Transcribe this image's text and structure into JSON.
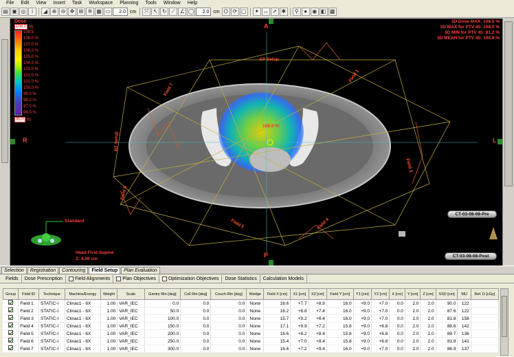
{
  "menu": [
    "File",
    "Edit",
    "View",
    "Insert",
    "Task",
    "Workspace",
    "Planning",
    "Tools",
    "Window",
    "Help"
  ],
  "toolbar": {
    "zoom_value": "2.0",
    "zoom_unit": "cm",
    "zoom2_value": "2.0",
    "zoom2_unit": "cm"
  },
  "dose_legend": {
    "title": "Dose",
    "max_value": "108.0",
    "unit": "%",
    "levels": [
      "108.5",
      "108.0 %",
      "107.0 %",
      "106.0 %",
      "105.0 %",
      "104.0 %",
      "103.0 %",
      "102.0 %",
      "101.0 %",
      "100.0 %",
      "99.0 %",
      "98.0 %",
      "97.0 %",
      "96.0 %"
    ],
    "min_value": "95.0"
  },
  "dose_stats": [
    "3D Dose MAX: 108.5 %",
    "3D MAX for PTV 45: 108.0 %",
    "3D MIN for PTV 45: 91.2 %",
    "3D MEAN for PTV 45: 100.9 %"
  ],
  "orientation": {
    "anterior": "A",
    "posterior": "P",
    "right": "R",
    "left": "L"
  },
  "isocenter_label": "108.9 %",
  "field_labels": [
    "AP Setup",
    "Field 1",
    "Field 2",
    "Field 3",
    "Field 4",
    "Field 5",
    "Field 6",
    "Field 7",
    "RT Setup"
  ],
  "patient": {
    "model_label": "Standard",
    "position": "Head First-Supine",
    "z": "Z: 4.00 cm"
  },
  "ct_tags": {
    "pre": "CT-03-08-08-Pre",
    "post": "CT-03-08-08-Post"
  },
  "workspace_tabs": [
    "Selection",
    "Registration",
    "Contouring",
    "Field Setup",
    "Plan Evaluation"
  ],
  "active_workspace_tab": "Field Setup",
  "sub_tabs": [
    {
      "label": "Fields",
      "checkbox": false
    },
    {
      "label": "Dose Prescription",
      "checkbox": false
    },
    {
      "label": "Field Alignments",
      "checkbox": true
    },
    {
      "label": "Plan Objectives",
      "checkbox": true
    },
    {
      "label": "Optimization Objectives",
      "checkbox": true
    },
    {
      "label": "Dose Statistics",
      "checkbox": false
    },
    {
      "label": "Calculation Models",
      "checkbox": false
    }
  ],
  "table": {
    "headers": [
      "Group",
      "Field ID",
      "Technique",
      "Machine/Energy",
      "Weight",
      "Scale",
      "Gantry Rtn [deg]",
      "Coll Rtn [deg]",
      "Couch Rtn [deg]",
      "Wedge",
      "Field X [cm]",
      "X1 [cm]",
      "X2 [cm]",
      "Field Y [cm]",
      "Y1 [cm]",
      "Y2 [cm]",
      "X [cm]",
      "Y [cm]",
      "Z [cm]",
      "SSD [cm]",
      "MU",
      "Ref. D [cGy]"
    ],
    "rows": [
      [
        "",
        "Field 1",
        "STATIC-I",
        "Clinac1 - 6X",
        "1.00",
        "VAR_IEC",
        "0.0",
        "0.0",
        "0.0",
        "None",
        "16.6",
        "+7.7",
        "+8.9",
        "16.0",
        "+9.0",
        "+7.0",
        "0.0",
        "2.0",
        "2.0",
        "90.0",
        "122",
        ""
      ],
      [
        "",
        "Field 2",
        "STATIC-I",
        "Clinac1 - 6X",
        "1.00",
        "VAR_IEC",
        "50.0",
        "0.0",
        "0.0",
        "None",
        "16.2",
        "+8.8",
        "+7.4",
        "16.0",
        "+9.0",
        "+7.0",
        "0.0",
        "2.0",
        "2.0",
        "87.6",
        "122",
        ""
      ],
      [
        "",
        "Field 3",
        "STATIC-I",
        "Clinac1 - 6X",
        "1.00",
        "VAR_IEC",
        "100.0",
        "0.0",
        "0.0",
        "None",
        "15.7",
        "+9.2",
        "+6.4",
        "16.0",
        "+9.0",
        "+7.0",
        "0.0",
        "2.0",
        "2.0",
        "81.8",
        "158",
        ""
      ],
      [
        "",
        "Field 4",
        "STATIC-I",
        "Clinac1 - 6X",
        "1.00",
        "VAR_IEC",
        "150.0",
        "0.0",
        "0.0",
        "None",
        "17.1",
        "+9.9",
        "+7.2",
        "15.8",
        "+9.0",
        "+6.8",
        "0.0",
        "2.0",
        "2.0",
        "88.6",
        "142",
        ""
      ],
      [
        "",
        "Field 5",
        "STATIC-I",
        "Clinac1 - 6X",
        "1.00",
        "VAR_IEC",
        "200.0",
        "0.0",
        "0.0",
        "None",
        "16.6",
        "+8.2",
        "+8.4",
        "15.8",
        "+9.0",
        "+6.8",
        "0.0",
        "2.0",
        "2.0",
        "89.7",
        "136",
        ""
      ],
      [
        "",
        "Field 6",
        "STATIC-I",
        "Clinac1 - 6X",
        "1.00",
        "VAR_IEC",
        "250.0",
        "0.0",
        "0.0",
        "None",
        "15.4",
        "+7.0",
        "+8.4",
        "15.8",
        "+9.0",
        "+6.8",
        "0.0",
        "2.0",
        "2.0",
        "81.9",
        "141",
        ""
      ],
      [
        "",
        "Field 7",
        "STATIC-I",
        "Clinac1 - 6X",
        "1.00",
        "VAR_IEC",
        "300.0",
        "0.0",
        "0.0",
        "None",
        "16.6",
        "+7.2",
        "+9.4",
        "16.0",
        "+9.0",
        "+7.0",
        "0.0",
        "2.0",
        "2.0",
        "86.9",
        "137",
        ""
      ]
    ]
  }
}
